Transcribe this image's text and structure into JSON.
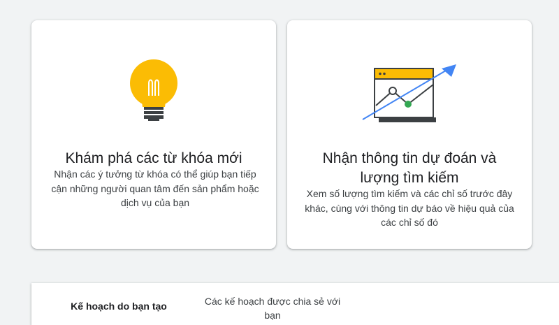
{
  "cards": [
    {
      "title": "Khám phá các từ khóa mới",
      "description": "Nhận các ý tưởng từ khóa có thể giúp bạn tiếp cận những người quan tâm đến sản phẩm hoặc dịch vụ của bạn",
      "icon": "lightbulb-icon"
    },
    {
      "title": "Nhận thông tin dự đoán và lượng tìm kiếm",
      "description": "Xem số lượng tìm kiếm và các chỉ số trước đây khác, cùng với thông tin dự báo về hiệu quả của các chỉ số đó",
      "icon": "forecast-chart-icon"
    }
  ],
  "tabs": [
    {
      "label": "Kế hoạch do bạn tạo"
    },
    {
      "label": "Các kế hoạch được chia sẻ với bạn"
    }
  ],
  "colors": {
    "background": "#f1f3f4",
    "bulb_yellow": "#fbbc04",
    "arrow_blue": "#4285f4",
    "dot_green": "#34a853",
    "dark_gray": "#3c4043"
  }
}
